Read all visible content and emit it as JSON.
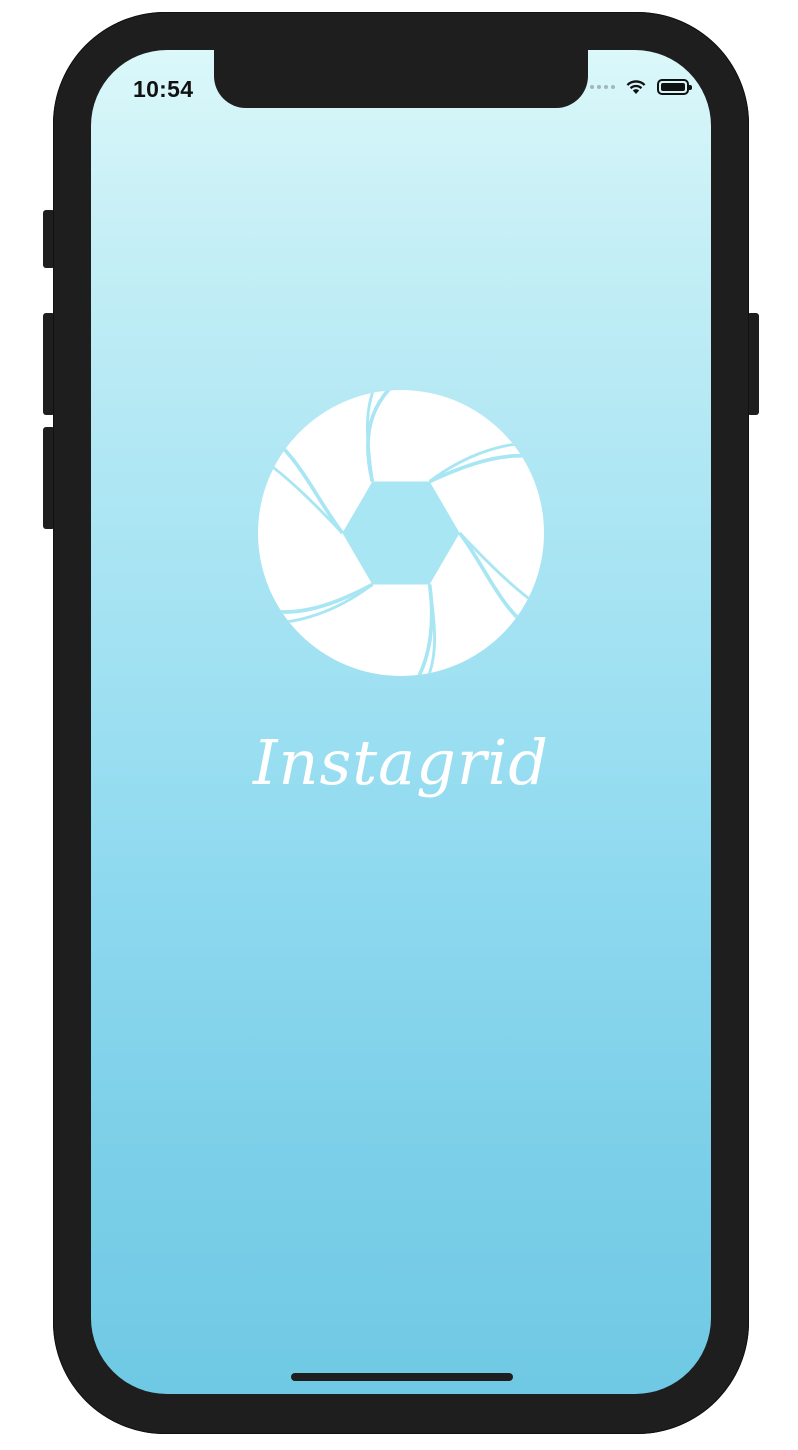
{
  "status_bar": {
    "time": "10:54",
    "wifi_icon": "wifi-icon",
    "battery_icon": "battery-icon",
    "battery_level": 1.0
  },
  "splash": {
    "logo_icon": "camera-shutter-icon",
    "app_name": "Instagrid"
  },
  "colors": {
    "gradient_top": "#dbf8fa",
    "gradient_bottom": "#6fc9e4",
    "logo": "#ffffff"
  }
}
